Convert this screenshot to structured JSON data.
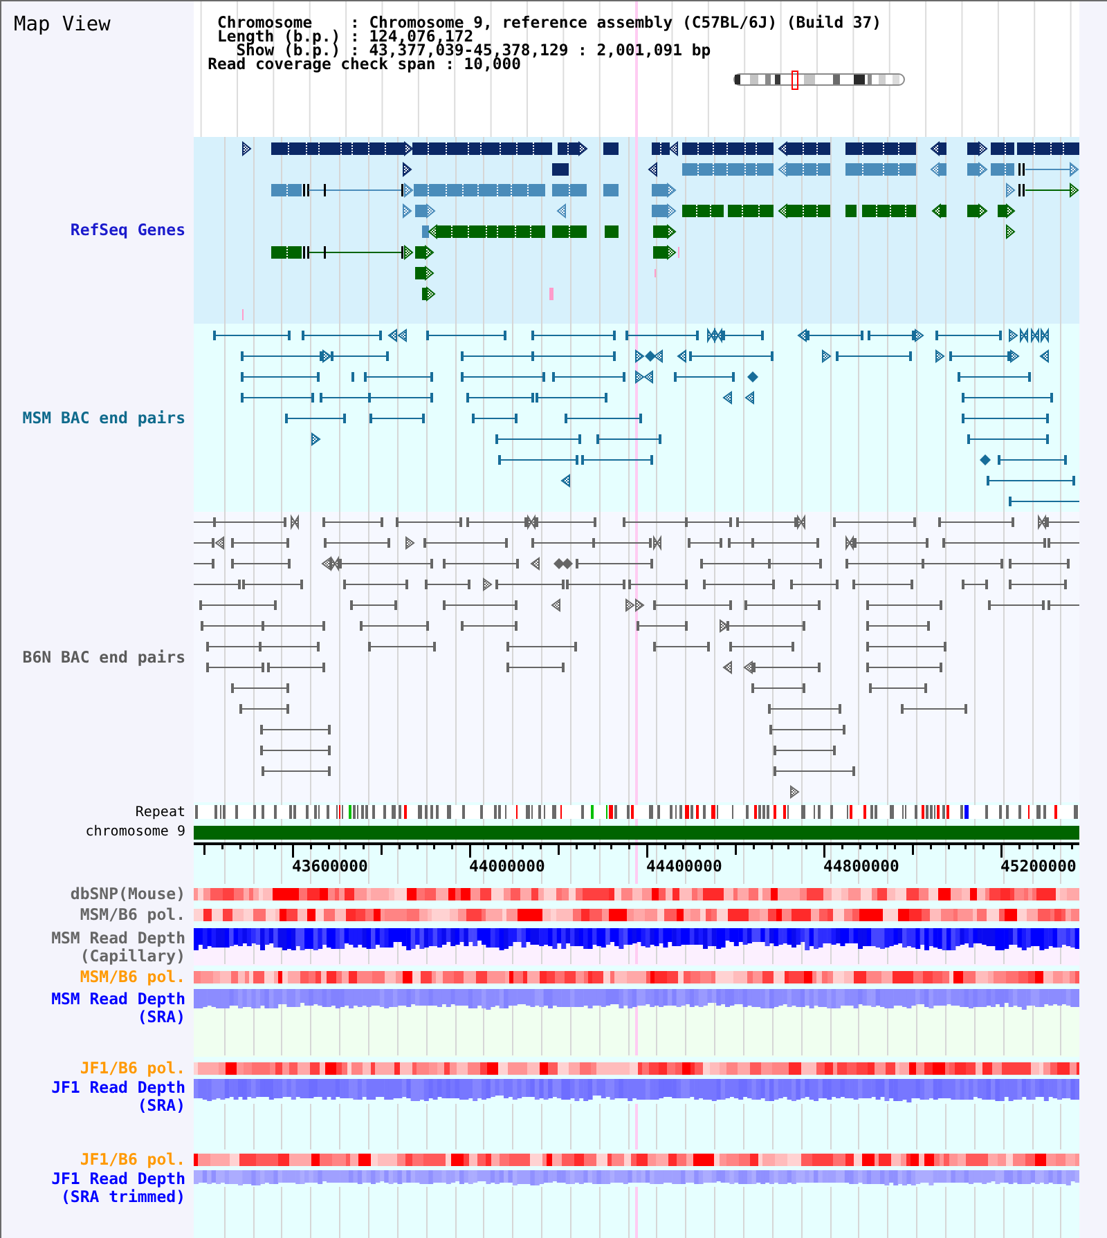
{
  "title": "Map View",
  "info": {
    "rows": [
      {
        "label": "Chromosome",
        "separator": ":",
        "value": "Chromosome 9, reference assembly (C57BL/6J) (Build 37)"
      },
      {
        "label": "Length (b.p.)",
        "separator": ":",
        "value": "124,076,172"
      },
      {
        "label": "Show (b.p.)",
        "separator": ":",
        "value": "43,377,039-45,378,129 : 2,001,091 bp"
      }
    ],
    "coverage_span": {
      "label": "Read coverage check span",
      "separator": ":",
      "value": "10,000"
    }
  },
  "feature_tracks": [
    {
      "label": "RefSeq Genes",
      "kind": "genes",
      "color": "#1a1acc"
    },
    {
      "label": "MSM BAC end pairs",
      "kind": "bac_pairs",
      "color": "#0f6a8c"
    },
    {
      "label": "B6N BAC end pairs",
      "kind": "bac_pairs",
      "color": "#5a5a5a"
    }
  ],
  "reference_tracks": [
    {
      "label": "Repeat",
      "kind": "repeat"
    },
    {
      "label": "chromosome 9",
      "kind": "chromosome"
    }
  ],
  "ruler": {
    "ticks": [
      "43600000",
      "44000000",
      "44400000",
      "44800000",
      "45200000"
    ]
  },
  "data_tracks": [
    {
      "label": "dbSNP(Mouse)",
      "kind": "heatmap",
      "color": "#666666"
    },
    {
      "label": "MSM/B6 pol.",
      "kind": "heatmap",
      "color": "#666666"
    },
    {
      "label": "MSM Read Depth (Capillary)",
      "kind": "capillary_depth",
      "color": "#666666"
    },
    {
      "label": "MSM/B6 pol.",
      "kind": "heatmap",
      "color": "#ff9900"
    },
    {
      "label": "MSM Read Depth (SRA)",
      "kind": "sra_depth",
      "color": "#0000ff"
    },
    {
      "label": "JF1/B6 pol.",
      "kind": "heatmap",
      "color": "#ff9900"
    },
    {
      "label": "JF1 Read Depth (SRA)",
      "kind": "sra_depth",
      "color": "#0000ff"
    },
    {
      "label": "JF1/B6 pol.",
      "kind": "heatmap",
      "color": "#ff9900"
    },
    {
      "label": "JF1 Read Depth (SRA trimmed)",
      "kind": "sra_depth",
      "color": "#0000ff"
    }
  ]
}
